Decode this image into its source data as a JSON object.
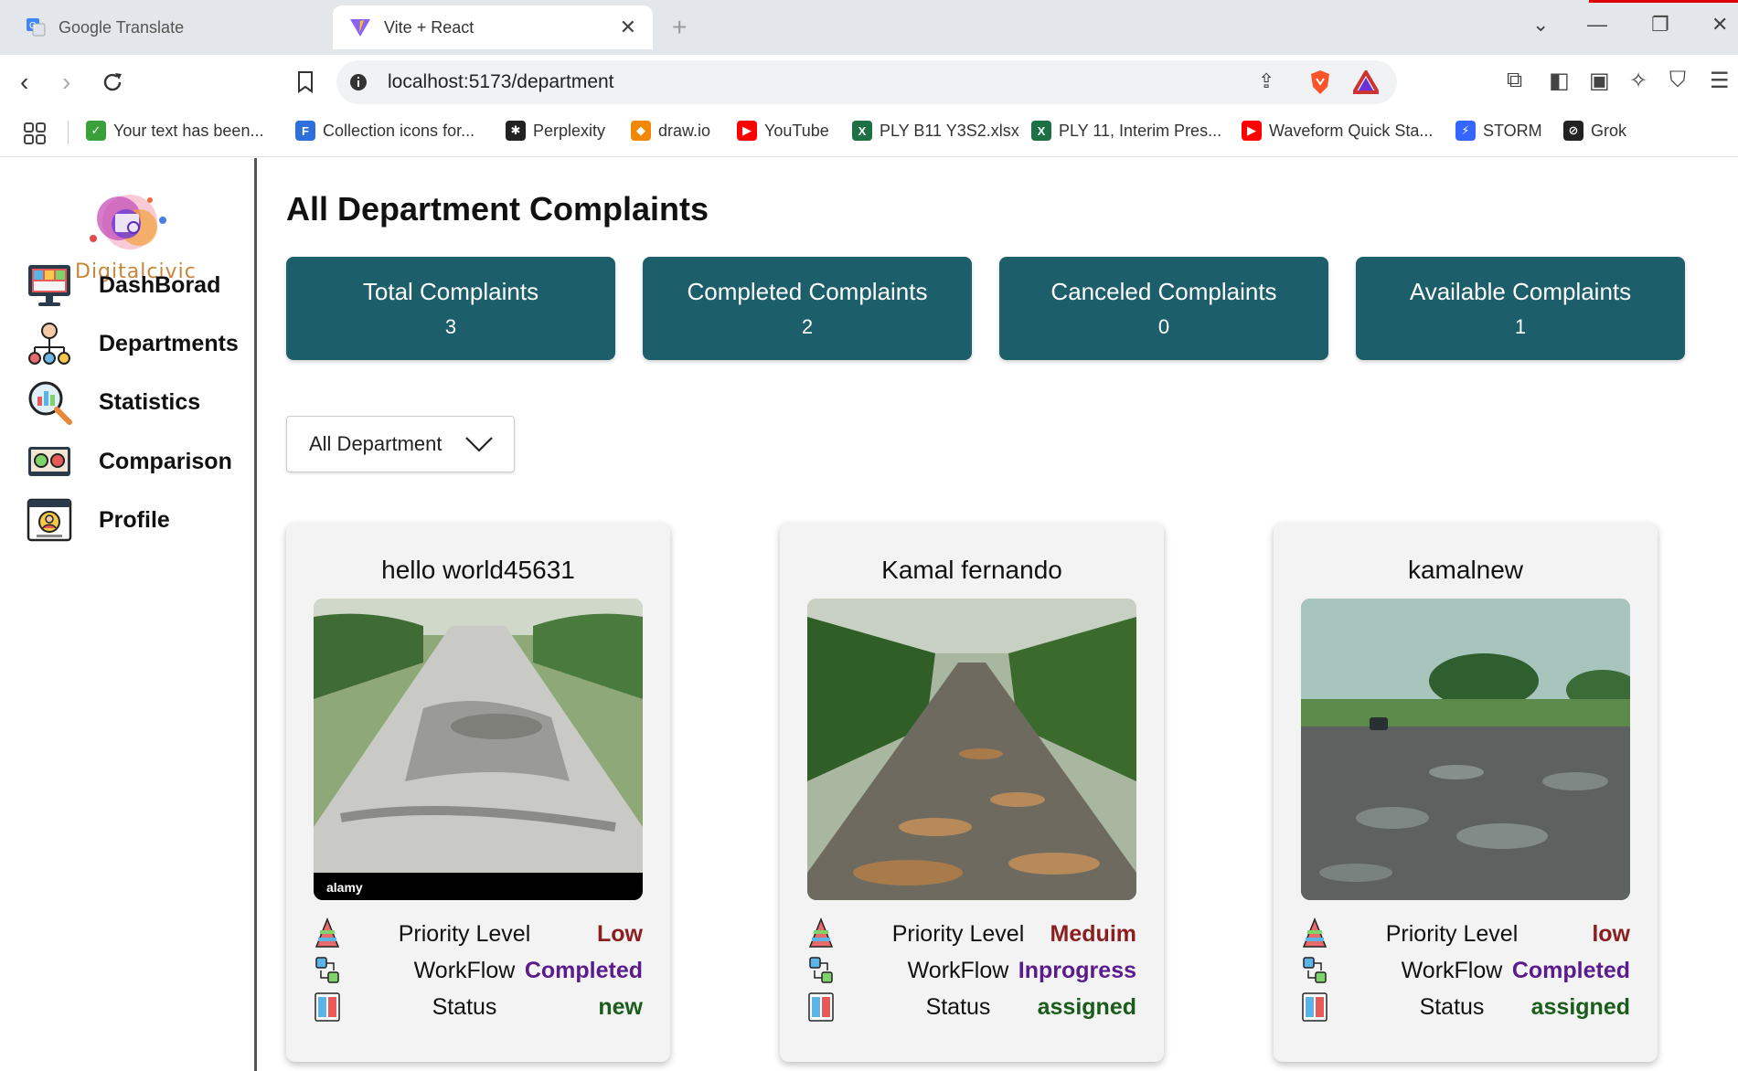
{
  "browser": {
    "tabs": [
      {
        "title": "Google Translate",
        "active": false
      },
      {
        "title": "Vite + React",
        "active": true
      }
    ],
    "url_host": "localhost",
    "url_path": ":5173/department",
    "bookmarks": [
      {
        "label": "Your text has been...",
        "icon": "check-icon",
        "color": "#3aa13a"
      },
      {
        "label": "Collection icons for...",
        "icon": "flaticon-icon",
        "color": "#2f6fdb"
      },
      {
        "label": "Perplexity",
        "icon": "perplexity-icon",
        "color": "#222222"
      },
      {
        "label": "draw.io",
        "icon": "drawio-icon",
        "color": "#f08705"
      },
      {
        "label": "YouTube",
        "icon": "youtube-icon",
        "color": "#ff0000"
      },
      {
        "label": "PLY B11 Y3S2.xlsx",
        "icon": "excel-icon",
        "color": "#1d7044"
      },
      {
        "label": "PLY 11, Interim Pres...",
        "icon": "excel-icon",
        "color": "#1d7044"
      },
      {
        "label": "Waveform Quick Sta...",
        "icon": "youtube-icon",
        "color": "#ff0000"
      },
      {
        "label": "STORM",
        "icon": "storm-icon",
        "color": "#3366ff"
      },
      {
        "label": "Grok",
        "icon": "grok-icon",
        "color": "#222222"
      }
    ]
  },
  "sidebar": {
    "logo_text": "Digitalcivic",
    "items": [
      {
        "label": "DashBorad",
        "icon": "dashboard-icon"
      },
      {
        "label": "Departments",
        "icon": "departments-icon"
      },
      {
        "label": "Statistics",
        "icon": "statistics-icon"
      },
      {
        "label": "Comparison",
        "icon": "comparison-icon"
      },
      {
        "label": "Profile",
        "icon": "profile-icon"
      }
    ]
  },
  "main": {
    "title": "All Department Complaints",
    "stats": [
      {
        "label": "Total Complaints",
        "value": "3"
      },
      {
        "label": "Completed Complaints",
        "value": "2"
      },
      {
        "label": "Canceled Complaints",
        "value": "0"
      },
      {
        "label": "Available Complaints",
        "value": "1"
      }
    ],
    "filter": {
      "selected": "All Department"
    },
    "row_labels": {
      "priority": "Priority Level",
      "workflow": "WorkFlow",
      "status": "Status"
    },
    "complaints": [
      {
        "title": "hello world45631",
        "priority": "Low",
        "workflow": "Completed",
        "status": "new",
        "watermark": "alamy"
      },
      {
        "title": "Kamal fernando",
        "priority": "Meduim",
        "workflow": "Inprogress",
        "status": "assigned"
      },
      {
        "title": "kamalnew",
        "priority": "low",
        "workflow": "Completed",
        "status": "assigned"
      }
    ]
  },
  "colors": {
    "stat_card_bg": "#1c5f6b",
    "priority_color": "#8b1e1e",
    "workflow_color": "#5b1b8c",
    "status_color": "#1a5c1a"
  }
}
